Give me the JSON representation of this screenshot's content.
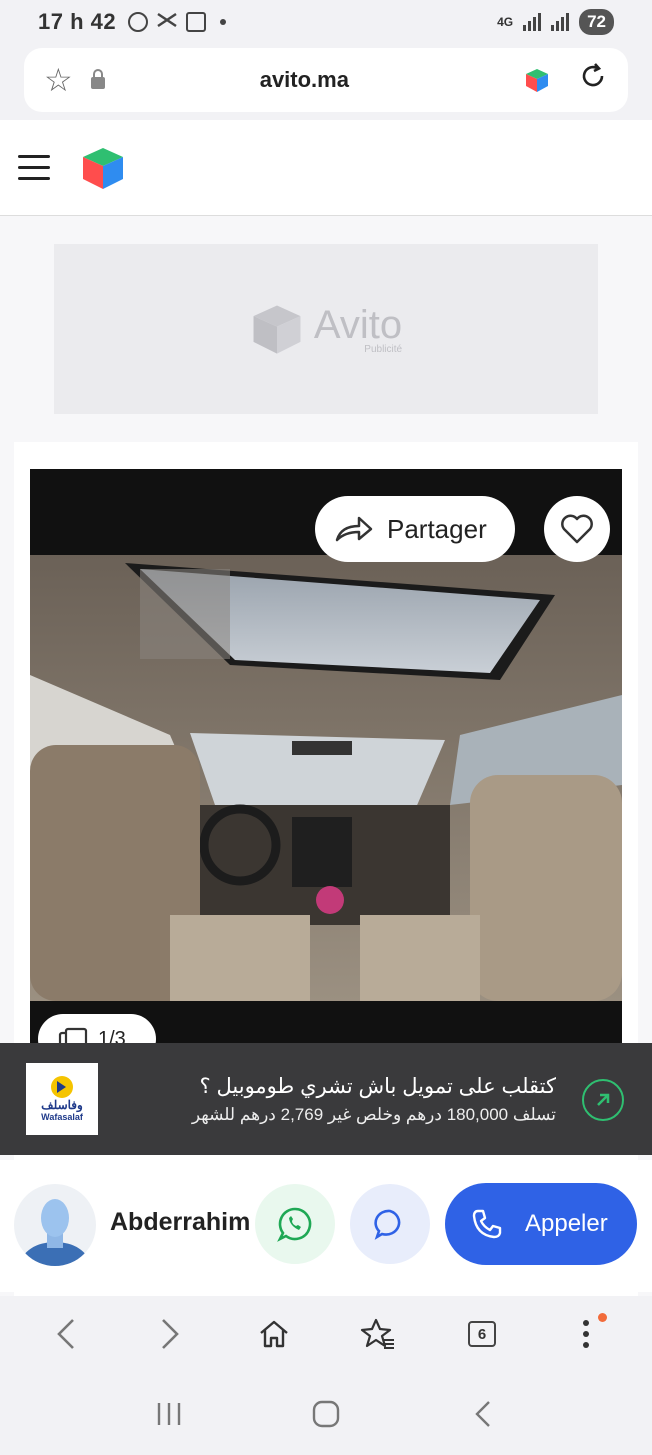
{
  "status_bar": {
    "time": "17 h 42",
    "network": "4G",
    "battery": "72"
  },
  "browser": {
    "url": "avito.ma",
    "tabs_count": "6"
  },
  "ad": {
    "brand": "Avito",
    "label": "Publicité"
  },
  "listing": {
    "share_label": "Partager",
    "photo_counter": "1/3"
  },
  "financing_banner": {
    "logo_arabic": "وفاسلف",
    "logo_latin": "Wafasalaf",
    "title": "كتقلب على تمويل باش تشري طوموبيل ؟",
    "subtitle": "تسلف 180,000 درهم وخلص غير 2,769 درهم للشهر",
    "accent_color": "#2fbf71"
  },
  "seller": {
    "name": "Abderrahim",
    "call_label": "Appeler",
    "call_color": "#2f62e6"
  }
}
